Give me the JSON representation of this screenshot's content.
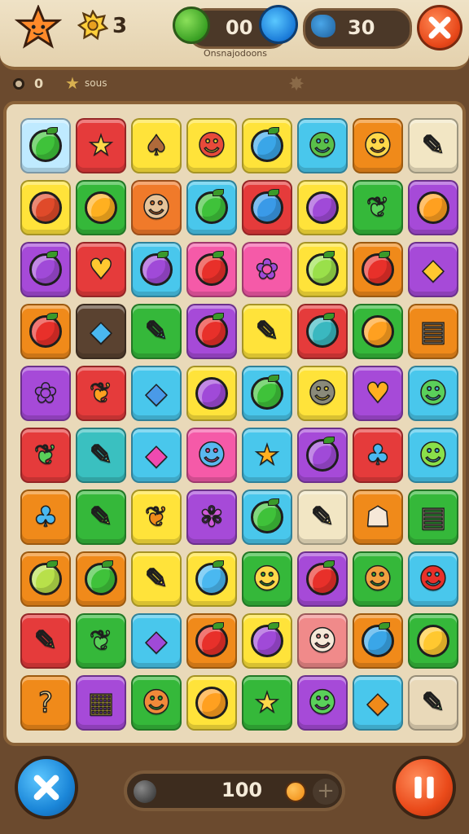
{
  "header": {
    "gear_count": "3",
    "green_coins": "00",
    "blue_coins": "30",
    "subtitle": "Onsnajodoons",
    "close_icon": "close-icon",
    "colors": {
      "accent_orange": "#e8481a",
      "accent_blue": "#1a7ad8",
      "bar_bg": "#4b3828"
    }
  },
  "status": {
    "level_count": "0",
    "label": "sous"
  },
  "board": {
    "tiles": [
      {
        "bg": "#bfeaff",
        "icon": "apple",
        "color": "#3fc23a"
      },
      {
        "bg": "#e53b3b",
        "icon": "star",
        "color": "#ffd84a"
      },
      {
        "bg": "#ffe33a",
        "icon": "acorn",
        "color": "#b06a3a"
      },
      {
        "bg": "#ffe33a",
        "icon": "creature",
        "color": "#e84a3a"
      },
      {
        "bg": "#ffe33a",
        "icon": "berry",
        "color": "#3aa6e8"
      },
      {
        "bg": "#49c7ec",
        "icon": "creature",
        "color": "#5ac04a"
      },
      {
        "bg": "#f08a1a",
        "icon": "creature",
        "color": "#ffd84a"
      },
      {
        "bg": "#f2e6c4",
        "icon": "crayon",
        "color": "#ffd84a"
      },
      {
        "bg": "#ffe33a",
        "icon": "pumpkin",
        "color": "#e04a2a"
      },
      {
        "bg": "#35b83a",
        "icon": "fruit",
        "color": "#ffb020"
      },
      {
        "bg": "#f07a2a",
        "icon": "fox",
        "color": "#e6c49a"
      },
      {
        "bg": "#49c7ec",
        "icon": "apple",
        "color": "#3fc23a"
      },
      {
        "bg": "#e53b3b",
        "icon": "berry",
        "color": "#3a9ae8"
      },
      {
        "bg": "#ffe33a",
        "icon": "eggplant",
        "color": "#a04ad8"
      },
      {
        "bg": "#35b83a",
        "icon": "leaf",
        "color": "#5ad05a"
      },
      {
        "bg": "#a64ad8",
        "icon": "fruit",
        "color": "#ffa020"
      },
      {
        "bg": "#a64ad8",
        "icon": "plum",
        "color": "#a04ad8"
      },
      {
        "bg": "#e53b3b",
        "icon": "heart",
        "color": "#ffc830"
      },
      {
        "bg": "#49c7ec",
        "icon": "plum",
        "color": "#a04ad8"
      },
      {
        "bg": "#f55aa8",
        "icon": "apple",
        "color": "#e8302a"
      },
      {
        "bg": "#f55aa8",
        "icon": "grapes",
        "color": "#a04ad8"
      },
      {
        "bg": "#ffe33a",
        "icon": "apple",
        "color": "#9ae04a"
      },
      {
        "bg": "#f08a1a",
        "icon": "apple",
        "color": "#e8302a"
      },
      {
        "bg": "#a64ad8",
        "icon": "gem",
        "color": "#ffc830"
      },
      {
        "bg": "#f08a1a",
        "icon": "apple",
        "color": "#e8302a"
      },
      {
        "bg": "#5a4230",
        "icon": "gem",
        "color": "#4ab8f0"
      },
      {
        "bg": "#35b83a",
        "icon": "crayon",
        "color": "#4ab8f0"
      },
      {
        "bg": "#a64ad8",
        "icon": "apple",
        "color": "#e8302a"
      },
      {
        "bg": "#ffe33a",
        "icon": "crayon",
        "color": "#3aa63a"
      },
      {
        "bg": "#e53b3b",
        "icon": "berry",
        "color": "#3ab8c0"
      },
      {
        "bg": "#35b83a",
        "icon": "fruit",
        "color": "#ffa020"
      },
      {
        "bg": "#f08a1a",
        "icon": "scroll",
        "color": "#f2e0b8"
      },
      {
        "bg": "#a64ad8",
        "icon": "grapes",
        "color": "#a04ad8"
      },
      {
        "bg": "#e53b3b",
        "icon": "leaf",
        "color": "#ffa020"
      },
      {
        "bg": "#49c7ec",
        "icon": "gem",
        "color": "#4a9ae8"
      },
      {
        "bg": "#ffe33a",
        "icon": "eggplant",
        "color": "#a04ad8"
      },
      {
        "bg": "#49c7ec",
        "icon": "apple",
        "color": "#3fc23a"
      },
      {
        "bg": "#ffe33a",
        "icon": "cat",
        "color": "#8a8a7a"
      },
      {
        "bg": "#a64ad8",
        "icon": "heart",
        "color": "#ffb020"
      },
      {
        "bg": "#49c7ec",
        "icon": "creature",
        "color": "#5ad05a"
      },
      {
        "bg": "#e53b3b",
        "icon": "leaf",
        "color": "#5ad05a"
      },
      {
        "bg": "#3ac0c0",
        "icon": "crayon",
        "color": "#ffd84a"
      },
      {
        "bg": "#49c7ec",
        "icon": "gem",
        "color": "#f04ab0"
      },
      {
        "bg": "#f55aa8",
        "icon": "creature",
        "color": "#5ab8f0"
      },
      {
        "bg": "#49c7ec",
        "icon": "star",
        "color": "#ffb020"
      },
      {
        "bg": "#a64ad8",
        "icon": "plum",
        "color": "#a04ad8"
      },
      {
        "bg": "#e53b3b",
        "icon": "lollipop",
        "color": "#4ab8f0"
      },
      {
        "bg": "#49c7ec",
        "icon": "creature",
        "color": "#8ae04a"
      },
      {
        "bg": "#f08a1a",
        "icon": "lollipop",
        "color": "#4ab8f0"
      },
      {
        "bg": "#35b83a",
        "icon": "crayon",
        "color": "#ffe33a"
      },
      {
        "bg": "#ffe33a",
        "icon": "leaf",
        "color": "#f08a1a"
      },
      {
        "bg": "#a64ad8",
        "icon": "flower",
        "color": "#d05ad8"
      },
      {
        "bg": "#49c7ec",
        "icon": "apple",
        "color": "#3fc23a"
      },
      {
        "bg": "#f2e6c4",
        "icon": "crayon",
        "color": "#ffe33a"
      },
      {
        "bg": "#f08a1a",
        "icon": "onion",
        "color": "#f6e8d8"
      },
      {
        "bg": "#35b83a",
        "icon": "scroll",
        "color": "#f2e0b8"
      },
      {
        "bg": "#f08a1a",
        "icon": "apple",
        "color": "#b8e04a"
      },
      {
        "bg": "#f08a1a",
        "icon": "apple",
        "color": "#3fc23a"
      },
      {
        "bg": "#ffe33a",
        "icon": "crayon",
        "color": "#a04ad8"
      },
      {
        "bg": "#ffe33a",
        "icon": "berry",
        "color": "#4ab8f0"
      },
      {
        "bg": "#35b83a",
        "icon": "bear",
        "color": "#ffd84a"
      },
      {
        "bg": "#a64ad8",
        "icon": "apple",
        "color": "#e8302a"
      },
      {
        "bg": "#35b83a",
        "icon": "bear",
        "color": "#f0a040"
      },
      {
        "bg": "#49c7ec",
        "icon": "creature",
        "color": "#e8302a"
      },
      {
        "bg": "#e53b3b",
        "icon": "crayon",
        "color": "#8ae04a"
      },
      {
        "bg": "#35b83a",
        "icon": "leaf",
        "color": "#5ad05a"
      },
      {
        "bg": "#49c7ec",
        "icon": "gem",
        "color": "#a04ad8"
      },
      {
        "bg": "#f08a1a",
        "icon": "apple",
        "color": "#e8302a"
      },
      {
        "bg": "#ffe33a",
        "icon": "plum",
        "color": "#a04ad8"
      },
      {
        "bg": "#f08a8a",
        "icon": "cat",
        "color": "#f6e8d8"
      },
      {
        "bg": "#f08a1a",
        "icon": "berry",
        "color": "#3aa6e8"
      },
      {
        "bg": "#35b83a",
        "icon": "fruit",
        "color": "#ffc830"
      },
      {
        "bg": "#f08a1a",
        "icon": "question",
        "color": "#f6d890"
      },
      {
        "bg": "#a64ad8",
        "icon": "box",
        "color": "#ffd84a"
      },
      {
        "bg": "#35b83a",
        "icon": "bear",
        "color": "#f08a3a"
      },
      {
        "bg": "#ffe33a",
        "icon": "fruit",
        "color": "#ffa020"
      },
      {
        "bg": "#35b83a",
        "icon": "star",
        "color": "#ffd84a"
      },
      {
        "bg": "#a64ad8",
        "icon": "creature",
        "color": "#5ad05a"
      },
      {
        "bg": "#49c7ec",
        "icon": "gem",
        "color": "#f08a1a"
      },
      {
        "bg": "#e9d9b9",
        "icon": "crayon",
        "color": "#5ad05a"
      }
    ]
  },
  "footer": {
    "score": "100",
    "close_icon": "close-icon",
    "pause_icon": "pause-icon"
  }
}
